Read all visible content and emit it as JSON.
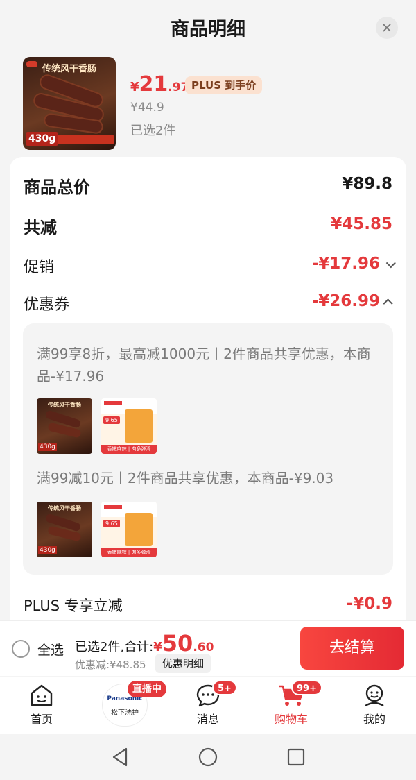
{
  "header": {
    "title": "商品明细"
  },
  "product": {
    "image_banner": "传统风干香肠",
    "image_weight": "430g",
    "price_currency": "¥",
    "price_integer": "21",
    "price_decimal": ".97",
    "plus_tag": "PLUS 到手价",
    "original_price": "¥44.9",
    "selected_count": "已选2件"
  },
  "breakdown": {
    "total_label": "商品总价",
    "total_value": "¥89.8",
    "reduce_label": "共减",
    "reduce_value": "¥45.85",
    "promo_label": "促销",
    "promo_value": "-¥17.96",
    "coupon_label": "优惠券",
    "coupon_value": "-¥26.99",
    "plus_label": "PLUS 专享立减",
    "plus_value": "-¥0.9"
  },
  "coupons": [
    {
      "text": "满99享8折，最高减1000元丨2件商品共享优惠，本商品-¥17.96"
    },
    {
      "text": "满99减10元丨2件商品共享优惠，本商品-¥9.03"
    }
  ],
  "mini_products": {
    "sausage_banner": "传统风干香肠",
    "sausage_weight": "430g",
    "snack_price": "9.65",
    "snack_footer": "香嫩麻辣 | 肉多弹滑"
  },
  "checkout": {
    "select_all": "全选",
    "summary_prefix": "已选2件,合计:",
    "total_currency": "¥",
    "total_integer": "50",
    "total_decimal": ".60",
    "discount": "优惠减:¥48.85",
    "detail_button": "优惠明细",
    "checkout_button": "去结算"
  },
  "tabs": {
    "home": "首页",
    "live_brand": "Panasonic",
    "live_sub": "松下洗护",
    "live_badge": "直播中",
    "messages": "消息",
    "messages_badge": "5+",
    "cart": "购物车",
    "cart_badge": "99+",
    "mine": "我的"
  },
  "colors": {
    "accent": "#e4393c",
    "plus_tag_bg": "#fbe1d0"
  }
}
